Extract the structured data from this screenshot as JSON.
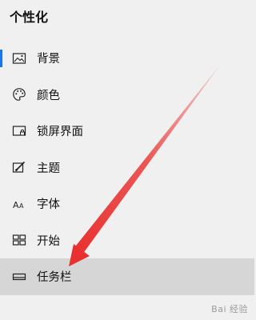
{
  "header": {
    "title": "个性化"
  },
  "nav": {
    "items": [
      {
        "label": "背景",
        "icon": "image-icon"
      },
      {
        "label": "颜色",
        "icon": "palette-icon"
      },
      {
        "label": "锁屏界面",
        "icon": "lock-screen-icon"
      },
      {
        "label": "主题",
        "icon": "theme-icon"
      },
      {
        "label": "字体",
        "icon": "font-icon"
      },
      {
        "label": "开始",
        "icon": "start-menu-icon"
      },
      {
        "label": "任务栏",
        "icon": "taskbar-icon"
      }
    ]
  },
  "watermark": {
    "text": "Bai 经验"
  },
  "colors": {
    "accent": "#1a73e8",
    "arrow": "#e8312f",
    "highlight": "#d6d6d6"
  }
}
